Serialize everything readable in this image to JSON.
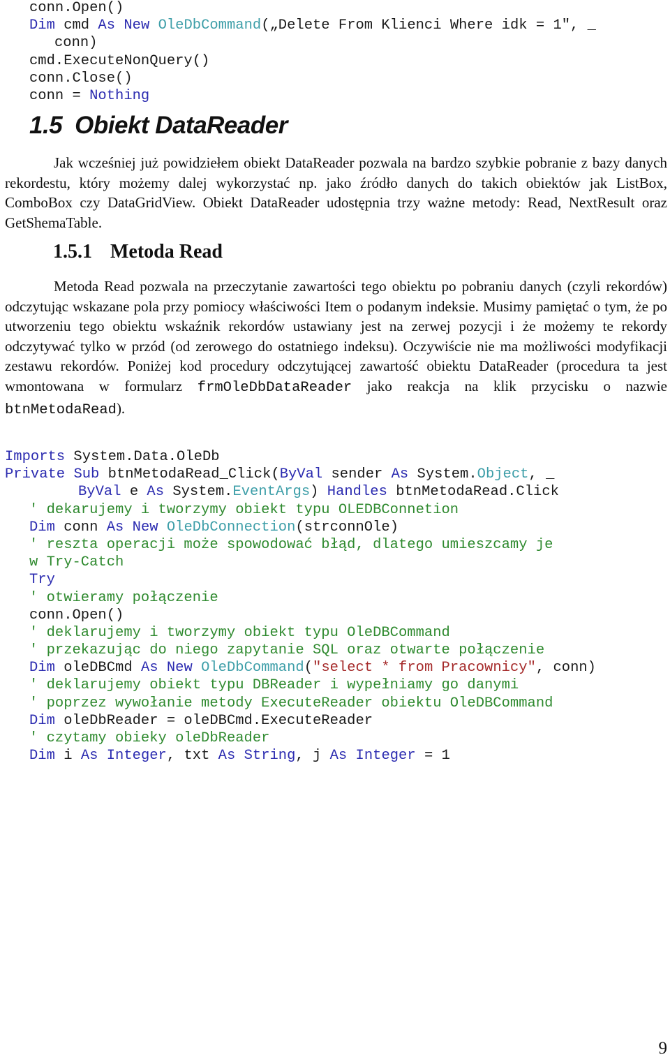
{
  "code_top": {
    "lines": [
      {
        "indent": 0,
        "tokens": [
          {
            "t": "conn.Open()",
            "c": ""
          }
        ]
      },
      {
        "indent": 0,
        "tokens": [
          {
            "t": "Dim",
            "c": "kw"
          },
          {
            "t": " cmd ",
            "c": ""
          },
          {
            "t": "As",
            "c": "kw"
          },
          {
            "t": " ",
            "c": ""
          },
          {
            "t": "New",
            "c": "kw"
          },
          {
            "t": " ",
            "c": ""
          },
          {
            "t": "OleDbCommand",
            "c": "ty"
          },
          {
            "t": "(„Delete From Klienci Where idk = 1″, _",
            "c": ""
          }
        ]
      },
      {
        "indent": 1,
        "tokens": [
          {
            "t": "conn)",
            "c": ""
          }
        ]
      },
      {
        "indent": 0,
        "tokens": [
          {
            "t": "cmd.ExecuteNonQuery()",
            "c": ""
          }
        ]
      },
      {
        "indent": 0,
        "tokens": [
          {
            "t": "conn.Close()",
            "c": ""
          }
        ]
      },
      {
        "indent": 0,
        "tokens": [
          {
            "t": "conn = ",
            "c": ""
          },
          {
            "t": "Nothing",
            "c": "kw"
          }
        ]
      }
    ]
  },
  "section": {
    "number": "1.5",
    "title": "Obiekt DataReader",
    "paragraph": "Jak wcześniej już powidziełem obiekt DataReader pozwala na bardzo szybkie pobranie z bazy danych rekordestu, który możemy dalej wykorzystać np. jako źródło danych do takich obiektów jak ListBox, ComboBox czy DataGridView. Obiekt DataReader udostępnia trzy ważne metody: Read, NextResult oraz GetShemaTable."
  },
  "subsection": {
    "number": "1.5.1",
    "title": "Metoda Read",
    "paragraph_part1": "Metoda Read pozwala na przeczytanie zawartości tego obiektu po pobraniu danych (czyli rekordów) odczytując wskazane pola przy pomiocy właściwości Item o podanym indeksie. Musimy pamiętać o tym, że po utworzeniu tego obiektu wskaźnik rekordów ustawiany jest na zerwej pozycji i że możemy te rekordy odczytywać tylko w przód (od zerowego do ostatniego indeksu). Oczywiście nie ma możliwości modyfikacji zestawu rekordów. Poniżej kod procedury odczytującej zawartość obiektu DataReader (procedura ta jest wmontowana w formularz ",
    "form_name": "frmOleDbDataReader",
    "paragraph_part2": " jako reakcja na klik przycisku o nazwie ",
    "button_name": "btnMetodaRead",
    "paragraph_part3": ")."
  },
  "code_main": {
    "lines": [
      {
        "indent": 0,
        "tokens": [
          {
            "t": "Imports",
            "c": "kw"
          },
          {
            "t": " System.Data.OleDb",
            "c": ""
          }
        ]
      },
      {
        "indent": 0,
        "tokens": [
          {
            "t": "Private",
            "c": "kw"
          },
          {
            "t": " ",
            "c": ""
          },
          {
            "t": "Sub",
            "c": "kw"
          },
          {
            "t": " btnMetodaRead_Click(",
            "c": ""
          },
          {
            "t": "ByVal",
            "c": "kw"
          },
          {
            "t": " sender ",
            "c": ""
          },
          {
            "t": "As",
            "c": "kw"
          },
          {
            "t": " System.",
            "c": ""
          },
          {
            "t": "Object",
            "c": "ty"
          },
          {
            "t": ", _",
            "c": ""
          }
        ]
      },
      {
        "indent": 2,
        "tokens": [
          {
            "t": "ByVal",
            "c": "kw"
          },
          {
            "t": " e ",
            "c": ""
          },
          {
            "t": "As",
            "c": "kw"
          },
          {
            "t": " System.",
            "c": ""
          },
          {
            "t": "EventArgs",
            "c": "ty"
          },
          {
            "t": ") ",
            "c": ""
          },
          {
            "t": "Handles",
            "c": "kw"
          },
          {
            "t": " btnMetodaRead.Click",
            "c": ""
          }
        ]
      },
      {
        "indent": 1,
        "tokens": [
          {
            "t": "' dekarujemy i tworzymy obiekt typu OLEDBConnetion",
            "c": "cm"
          }
        ]
      },
      {
        "indent": 1,
        "tokens": [
          {
            "t": "Dim",
            "c": "kw"
          },
          {
            "t": " conn ",
            "c": ""
          },
          {
            "t": "As",
            "c": "kw"
          },
          {
            "t": " ",
            "c": ""
          },
          {
            "t": "New",
            "c": "kw"
          },
          {
            "t": " ",
            "c": ""
          },
          {
            "t": "OleDbConnection",
            "c": "ty"
          },
          {
            "t": "(strconnOle)",
            "c": ""
          }
        ]
      },
      {
        "indent": 1,
        "tokens": [
          {
            "t": "' reszta operacji może spowodować błąd, dlatego umieszcamy je",
            "c": "cm"
          }
        ]
      },
      {
        "indent": 1,
        "tokens": [
          {
            "t": "w Try-Catch",
            "c": "cm"
          }
        ]
      },
      {
        "indent": 1,
        "tokens": [
          {
            "t": "Try",
            "c": "kw"
          }
        ]
      },
      {
        "indent": 1,
        "tokens": [
          {
            "t": "' otwieramy połączenie",
            "c": "cm"
          }
        ]
      },
      {
        "indent": 1,
        "tokens": [
          {
            "t": "conn.Open()",
            "c": ""
          }
        ]
      },
      {
        "indent": 1,
        "tokens": [
          {
            "t": "' deklarujemy i tworzymy obiekt typu OleDBCommand",
            "c": "cm"
          }
        ]
      },
      {
        "indent": 1,
        "tokens": [
          {
            "t": "' przekazując do niego zapytanie SQL oraz otwarte połączenie",
            "c": "cm"
          }
        ]
      },
      {
        "indent": 1,
        "tokens": [
          {
            "t": "Dim",
            "c": "kw"
          },
          {
            "t": " oleDBCmd ",
            "c": ""
          },
          {
            "t": "As",
            "c": "kw"
          },
          {
            "t": " ",
            "c": ""
          },
          {
            "t": "New",
            "c": "kw"
          },
          {
            "t": " ",
            "c": ""
          },
          {
            "t": "OleDbCommand",
            "c": "ty"
          },
          {
            "t": "(",
            "c": ""
          },
          {
            "t": "\"select * from Pracownicy\"",
            "c": "st"
          },
          {
            "t": ", conn)",
            "c": ""
          }
        ]
      },
      {
        "indent": 1,
        "tokens": [
          {
            "t": "' deklarujemy obiekt typu DBReader i wypełniamy go danymi",
            "c": "cm"
          }
        ]
      },
      {
        "indent": 1,
        "tokens": [
          {
            "t": "' poprzez wywołanie metody ExecuteReader obiektu OleDBCommand",
            "c": "cm"
          }
        ]
      },
      {
        "indent": 1,
        "tokens": [
          {
            "t": "Dim",
            "c": "kw"
          },
          {
            "t": " oleDbReader = oleDBCmd.ExecuteReader",
            "c": ""
          }
        ]
      },
      {
        "indent": 1,
        "tokens": [
          {
            "t": "' czytamy obieky oleDbReader",
            "c": "cm"
          }
        ]
      },
      {
        "indent": 1,
        "tokens": [
          {
            "t": "Dim",
            "c": "kw"
          },
          {
            "t": " i ",
            "c": ""
          },
          {
            "t": "As",
            "c": "kw"
          },
          {
            "t": " ",
            "c": ""
          },
          {
            "t": "Integer",
            "c": "kw"
          },
          {
            "t": ", txt ",
            "c": ""
          },
          {
            "t": "As",
            "c": "kw"
          },
          {
            "t": " ",
            "c": ""
          },
          {
            "t": "String",
            "c": "kw"
          },
          {
            "t": ", j ",
            "c": ""
          },
          {
            "t": "As",
            "c": "kw"
          },
          {
            "t": " ",
            "c": ""
          },
          {
            "t": "Integer",
            "c": "kw"
          },
          {
            "t": " = 1",
            "c": ""
          }
        ]
      }
    ]
  },
  "colors": {
    "keyword": "#2b2bb0",
    "type": "#3d9ea8",
    "comment": "#2f8a2f",
    "string": "#a52a2a",
    "text": "#111111"
  },
  "page_number": "9"
}
